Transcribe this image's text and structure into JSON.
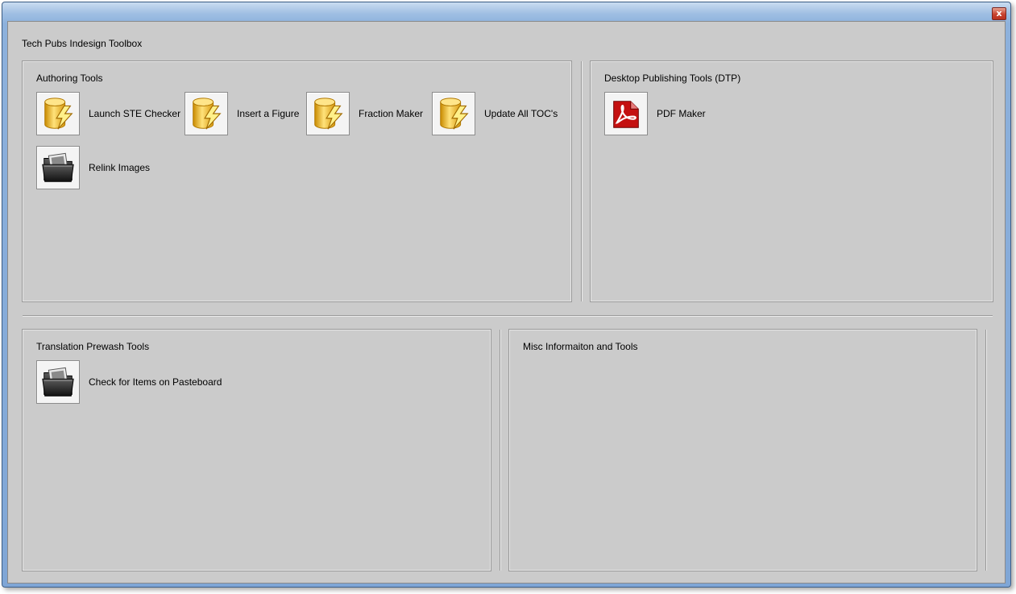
{
  "window": {
    "title": "Tech Pubs Indesign Toolbox",
    "close_label": "x"
  },
  "authoring": {
    "title": "Authoring Tools",
    "tools": [
      {
        "label": "Launch STE Checker",
        "icon": "lightning-database-icon"
      },
      {
        "label": "Insert a Figure",
        "icon": "lightning-database-icon"
      },
      {
        "label": "Fraction Maker",
        "icon": "lightning-database-icon"
      },
      {
        "label": "Update All TOC's",
        "icon": "lightning-database-icon"
      },
      {
        "label": "Relink Images",
        "icon": "image-folder-icon"
      }
    ]
  },
  "dtp": {
    "title": "Desktop Publishing Tools (DTP)",
    "tools": [
      {
        "label": "PDF Maker",
        "icon": "pdf-document-icon"
      }
    ]
  },
  "translation": {
    "title": "Translation Prewash Tools",
    "tools": [
      {
        "label": "Check for Items on Pasteboard",
        "icon": "image-folder-icon"
      }
    ]
  },
  "misc": {
    "title": "Misc Informaiton and Tools"
  },
  "colors": {
    "panel_bg": "#cbcbcb",
    "title_bar": "#8db1dc",
    "close_button": "#c8422f"
  }
}
